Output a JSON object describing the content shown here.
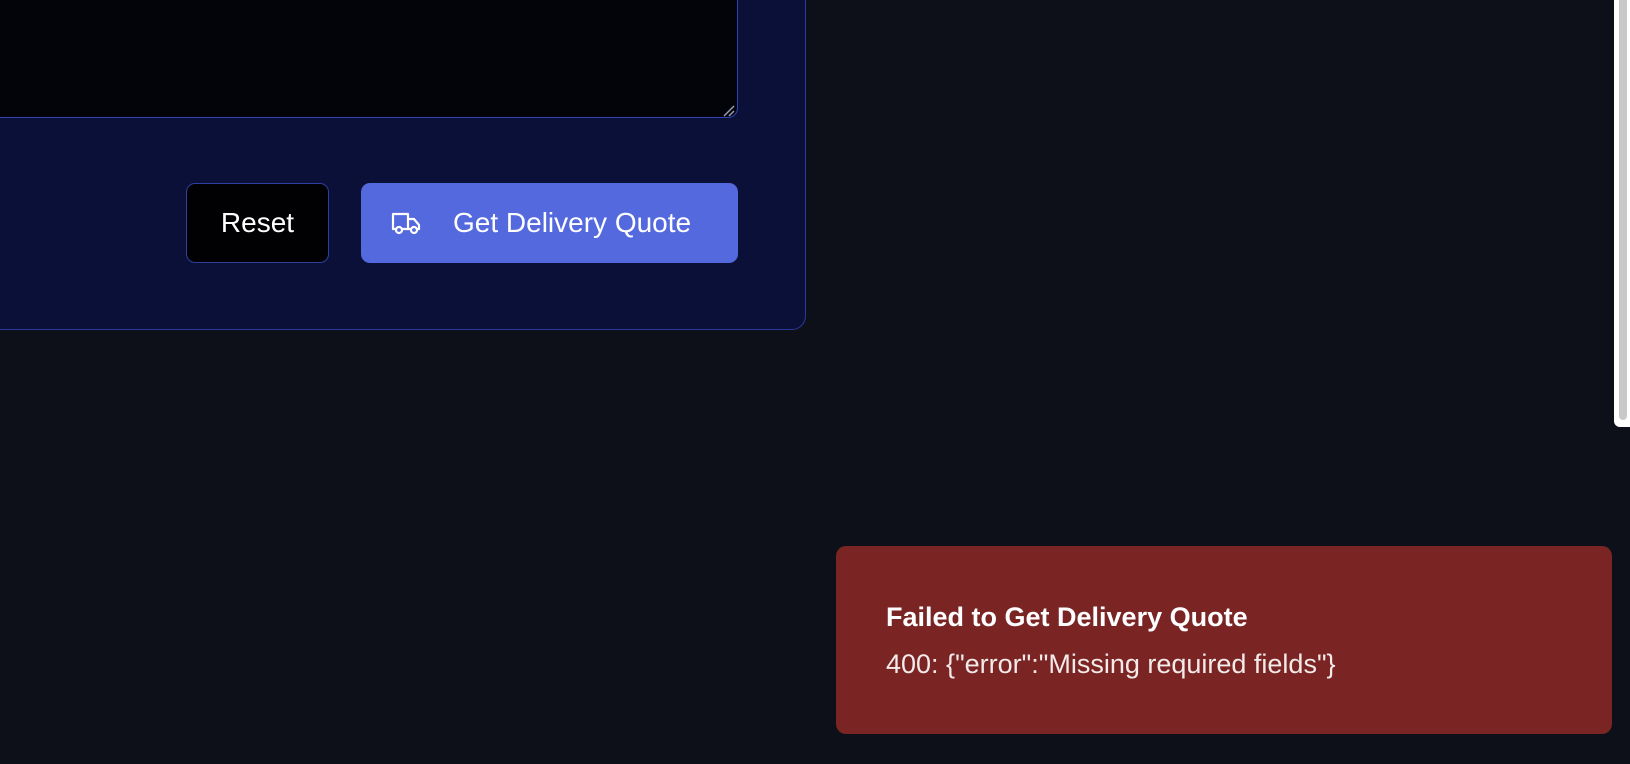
{
  "form": {
    "reset_label": "Reset",
    "submit_label": "Get Delivery Quote",
    "submit_icon": "truck-icon",
    "accent_color": "#5469de",
    "card_color": "#0b1038"
  },
  "toast": {
    "title": "Failed to Get Delivery Quote",
    "message": "400: {\"error\":\"Missing required fields\"}",
    "color": "#7a2424"
  },
  "page": {
    "background": "#0d1018"
  }
}
